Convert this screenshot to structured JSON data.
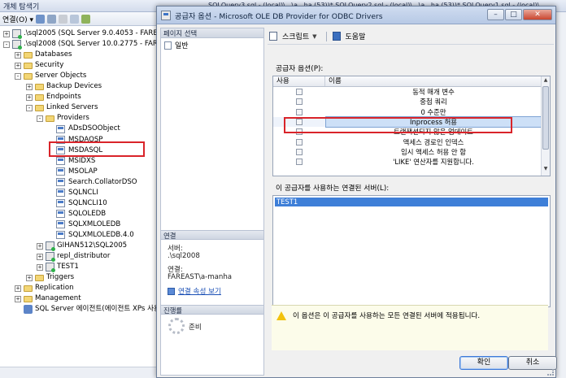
{
  "object_explorer": {
    "title": "개체 탐색기",
    "toolbar": {
      "connect_label": "연결(O) ▾"
    },
    "tree": [
      {
        "label": ".\\sql2005 (SQL Server 9.0.4053 - FAREAST\\",
        "indent": 0,
        "expander": "+",
        "icon": "server"
      },
      {
        "label": ".\\sql2008 (SQL Server 10.0.2775 - FAREAST\\",
        "indent": 0,
        "expander": "-",
        "icon": "server"
      },
      {
        "label": "Databases",
        "indent": 1,
        "expander": "+",
        "icon": "folder"
      },
      {
        "label": "Security",
        "indent": 1,
        "expander": "+",
        "icon": "folder"
      },
      {
        "label": "Server Objects",
        "indent": 1,
        "expander": "-",
        "icon": "folder"
      },
      {
        "label": "Backup Devices",
        "indent": 2,
        "expander": "+",
        "icon": "folder"
      },
      {
        "label": "Endpoints",
        "indent": 2,
        "expander": "+",
        "icon": "folder"
      },
      {
        "label": "Linked Servers",
        "indent": 2,
        "expander": "-",
        "icon": "folder"
      },
      {
        "label": "Providers",
        "indent": 3,
        "expander": "-",
        "icon": "folder"
      },
      {
        "label": "ADsDSOObject",
        "indent": 4,
        "expander": "",
        "icon": "provider"
      },
      {
        "label": "MSDAOSP",
        "indent": 4,
        "expander": "",
        "icon": "provider"
      },
      {
        "label": "MSDASQL",
        "indent": 4,
        "expander": "",
        "icon": "provider"
      },
      {
        "label": "MSIDXS",
        "indent": 4,
        "expander": "",
        "icon": "provider"
      },
      {
        "label": "MSOLAP",
        "indent": 4,
        "expander": "",
        "icon": "provider"
      },
      {
        "label": "Search.CollatorDSO",
        "indent": 4,
        "expander": "",
        "icon": "provider"
      },
      {
        "label": "SQLNCLI",
        "indent": 4,
        "expander": "",
        "icon": "provider"
      },
      {
        "label": "SQLNCLI10",
        "indent": 4,
        "expander": "",
        "icon": "provider"
      },
      {
        "label": "SQLOLEDB",
        "indent": 4,
        "expander": "",
        "icon": "provider"
      },
      {
        "label": "SQLXMLOLEDB",
        "indent": 4,
        "expander": "",
        "icon": "provider"
      },
      {
        "label": "SQLXMLOLEDB.4.0",
        "indent": 4,
        "expander": "",
        "icon": "provider"
      },
      {
        "label": "GIHAN512\\SQL2005",
        "indent": 3,
        "expander": "+",
        "icon": "server"
      },
      {
        "label": "repl_distributor",
        "indent": 3,
        "expander": "+",
        "icon": "server"
      },
      {
        "label": "TEST1",
        "indent": 3,
        "expander": "+",
        "icon": "server"
      },
      {
        "label": "Triggers",
        "indent": 2,
        "expander": "+",
        "icon": "folder"
      },
      {
        "label": "Replication",
        "indent": 1,
        "expander": "+",
        "icon": "folder"
      },
      {
        "label": "Management",
        "indent": 1,
        "expander": "+",
        "icon": "folder"
      },
      {
        "label": "SQL Server 에이전트(에이전트 XPs 사용",
        "indent": 1,
        "expander": "",
        "icon": "agent"
      }
    ]
  },
  "background_tabs": "SQLQuery3.sql - (local)\\...\\a...ha (53))*    SQLQuery2.sql - (local)\\...\\a...ha (53))*    SQLQuery1.sql - (local)\\...",
  "dialog": {
    "title": "공급자 옵션 - Microsoft OLE DB Provider for ODBC Drivers",
    "window_buttons": {
      "minimize": "–",
      "maximize": "□",
      "close": "✕"
    },
    "left_pane": {
      "select_page_header": "페이지 선택",
      "pages": [
        "일반"
      ],
      "connection_header": "연결",
      "server_label": "서버:",
      "server_value": ".\\sql2008",
      "connection_label": "연결:",
      "connection_value": "FAREAST\\a-manha",
      "view_connection_link": "연결 속성 보기",
      "progress_header": "진행률",
      "progress_status": "준비"
    },
    "toolbar": {
      "script_label": "스크립트",
      "help_label": "도움말"
    },
    "options_label": "공급자 옵션(P):",
    "grid": {
      "columns": [
        "사용",
        "이름"
      ],
      "rows": [
        {
          "name": "동적 매개 변수"
        },
        {
          "name": "중첩 쿼리"
        },
        {
          "name": "0 수준만"
        },
        {
          "name": "Inprocess 허용"
        },
        {
          "name": "트랜잭션되지 않은 업데이트"
        },
        {
          "name": "액세스 경로인 인덱스"
        },
        {
          "name": "임시 액세스 허용 안 함"
        },
        {
          "name": "'LIKE' 연산자를 지원합니다."
        }
      ],
      "selected_index": 3
    },
    "linked_servers_label": "이 공급자를 사용하는 연결된 서버(L):",
    "linked_servers": [
      "TEST1"
    ],
    "note": "이 옵션은 이 공급자를 사용하는 모든 연결된 서버에 적용됩니다.",
    "ok_label": "확인",
    "cancel_label": "취소"
  },
  "colors": {
    "highlight_box": "#d9242a",
    "selection": "#3e7fd8",
    "note_bg": "#fcfcea"
  }
}
